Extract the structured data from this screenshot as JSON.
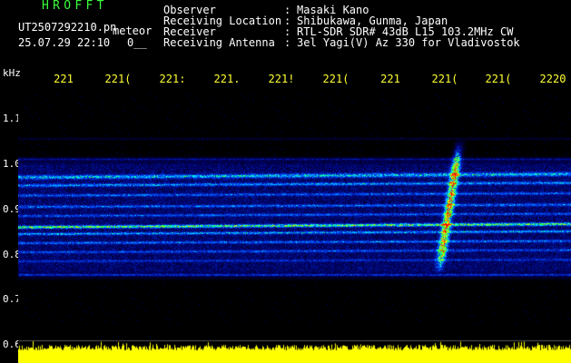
{
  "header": {
    "app_title": "HROFFT",
    "file_name": "UT2507292210.pn",
    "meteor_label": "meteor",
    "datetime": "25.07.29 22:10",
    "counter": "0__",
    "info": [
      {
        "key": "Observer",
        "value": "Masaki Kano"
      },
      {
        "key": "Receiving Location",
        "value": "Shibukawa, Gunma, Japan"
      },
      {
        "key": "Receiver",
        "value": "RTL-SDR SDR# 43dB L15 103.2MHz CW"
      },
      {
        "key": "Receiving Antenna",
        "value": "3el Yagi(V) Az 330 for Vladivostok"
      }
    ],
    "separator": ":"
  },
  "axes": {
    "y_unit": "kHz",
    "y_ticks": [
      "1.1",
      "1.0",
      "0.9",
      "0.8",
      "0.7",
      "0.6"
    ],
    "x_ticks": [
      "221",
      "221(",
      "221:",
      "221.",
      "221!",
      "221(",
      "221",
      "221(",
      "221(",
      "2220"
    ]
  },
  "colors": {
    "background": "#000000",
    "title": "#39ff3c",
    "tick_labels": "#ffff33",
    "text": "#ffffff"
  }
}
